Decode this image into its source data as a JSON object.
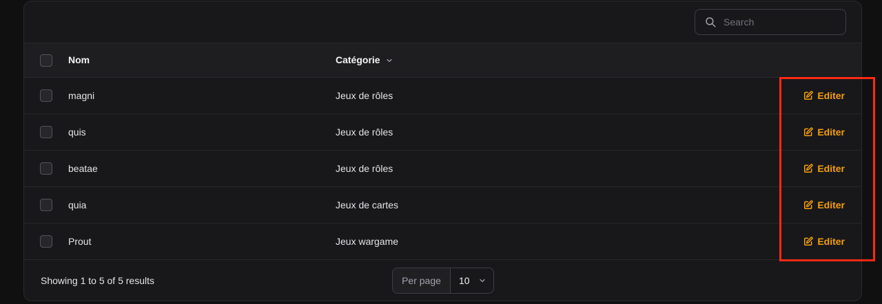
{
  "search": {
    "placeholder": "Search",
    "value": "",
    "icon": "search-icon"
  },
  "table": {
    "columns": [
      {
        "label": "Nom"
      },
      {
        "label": "Catégorie",
        "sortable": true
      }
    ],
    "rows": [
      {
        "name": "magni",
        "category": "Jeux de rôles",
        "action": "Editer"
      },
      {
        "name": "quis",
        "category": "Jeux de rôles",
        "action": "Editer"
      },
      {
        "name": "beatae",
        "category": "Jeux de rôles",
        "action": "Editer"
      },
      {
        "name": "quia",
        "category": "Jeux de cartes",
        "action": "Editer"
      },
      {
        "name": "Prout",
        "category": "Jeux wargame",
        "action": "Editer"
      }
    ]
  },
  "footer": {
    "results_text": "Showing 1 to 5 of 5 results",
    "per_page_label": "Per page",
    "per_page_value": "10"
  },
  "colors": {
    "accent": "#f59e0b",
    "highlight": "#ff2a12",
    "background": "#18181b"
  }
}
